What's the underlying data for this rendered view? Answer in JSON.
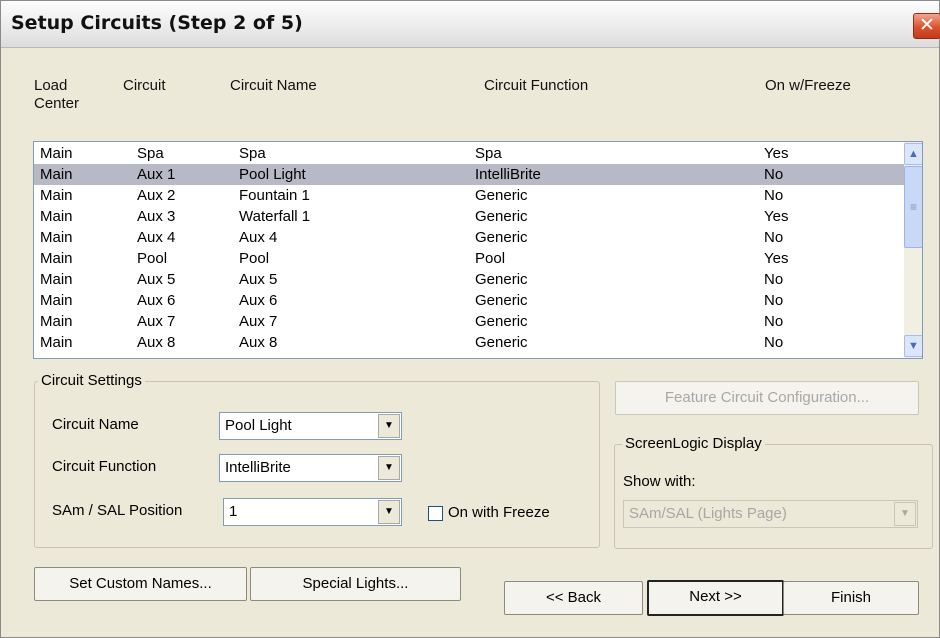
{
  "window": {
    "title": "Setup Circuits (Step 2 of 5)",
    "close_glyph": "✕"
  },
  "columns": {
    "load_center": "Load\nCenter",
    "circuit": "Circuit",
    "circuit_name": "Circuit Name",
    "circuit_function": "Circuit Function",
    "on_w_freeze": "On w/Freeze"
  },
  "rows": [
    {
      "load_center": "Main",
      "circuit": "Spa",
      "name": "Spa",
      "function": "Spa",
      "freeze": "Yes",
      "selected": false
    },
    {
      "load_center": "Main",
      "circuit": "Aux 1",
      "name": "Pool Light",
      "function": "IntelliBrite",
      "freeze": "No",
      "selected": true
    },
    {
      "load_center": "Main",
      "circuit": "Aux 2",
      "name": "Fountain 1",
      "function": "Generic",
      "freeze": "No",
      "selected": false
    },
    {
      "load_center": "Main",
      "circuit": "Aux 3",
      "name": "Waterfall 1",
      "function": "Generic",
      "freeze": "Yes",
      "selected": false
    },
    {
      "load_center": "Main",
      "circuit": "Aux 4",
      "name": "Aux 4",
      "function": "Generic",
      "freeze": "No",
      "selected": false
    },
    {
      "load_center": "Main",
      "circuit": "Pool",
      "name": "Pool",
      "function": "Pool",
      "freeze": "Yes",
      "selected": false
    },
    {
      "load_center": "Main",
      "circuit": "Aux 5",
      "name": "Aux 5",
      "function": "Generic",
      "freeze": "No",
      "selected": false
    },
    {
      "load_center": "Main",
      "circuit": "Aux 6",
      "name": "Aux 6",
      "function": "Generic",
      "freeze": "No",
      "selected": false
    },
    {
      "load_center": "Main",
      "circuit": "Aux 7",
      "name": "Aux 7",
      "function": "Generic",
      "freeze": "No",
      "selected": false
    },
    {
      "load_center": "Main",
      "circuit": "Aux 8",
      "name": "Aux 8",
      "function": "Generic",
      "freeze": "No",
      "selected": false
    }
  ],
  "scrollbar": {
    "up_icon": "chevron-up-icon",
    "down_icon": "chevron-down-icon",
    "up_glyph": "▲",
    "down_glyph": "▼",
    "thumb_glyph": "≡"
  },
  "circuit_settings": {
    "legend": "Circuit Settings",
    "name_label": "Circuit Name",
    "name_value": "Pool Light",
    "function_label": "Circuit Function",
    "function_value": "IntelliBrite",
    "position_label": "SAm / SAL Position",
    "position_value": "1",
    "freeze_label": "On with Freeze",
    "freeze_checked": false
  },
  "feature_button": "Feature Circuit Configuration...",
  "screenlogic": {
    "legend": "ScreenLogic Display",
    "show_with_label": "Show with:",
    "show_with_value": "SAm/SAL (Lights Page)"
  },
  "buttons": {
    "custom_names": "Set Custom Names...",
    "special_lights": "Special Lights...",
    "back": "<< Back",
    "next": "Next >>",
    "finish": "Finish"
  },
  "combo_arrow_glyph": "▼",
  "colors": {
    "dialog_bg": "#ece9d8",
    "selection": "#b7b9c6",
    "close_button": "#d9532f"
  }
}
